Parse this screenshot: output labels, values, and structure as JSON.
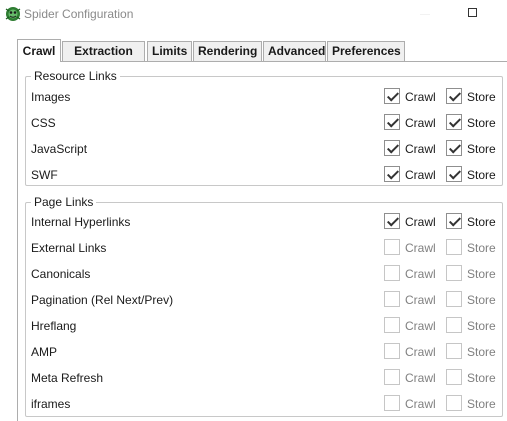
{
  "window": {
    "title": "Spider Configuration",
    "icon": "spider-frog-icon"
  },
  "tabs": [
    {
      "label": "Crawl",
      "active": true
    },
    {
      "label": "Extraction",
      "active": false
    },
    {
      "label": "Limits",
      "active": false
    },
    {
      "label": "Rendering",
      "active": false
    },
    {
      "label": "Advanced",
      "active": false
    },
    {
      "label": "Preferences",
      "active": false
    }
  ],
  "resource_links": {
    "legend": "Resource Links",
    "crawl_label": "Crawl",
    "store_label": "Store",
    "rows": [
      {
        "label": "Images",
        "crawl": true,
        "store": true
      },
      {
        "label": "CSS",
        "crawl": true,
        "store": true
      },
      {
        "label": "JavaScript",
        "crawl": true,
        "store": true
      },
      {
        "label": "SWF",
        "crawl": true,
        "store": true
      }
    ]
  },
  "page_links": {
    "legend": "Page Links",
    "crawl_label": "Crawl",
    "store_label": "Store",
    "rows": [
      {
        "label": "Internal Hyperlinks",
        "crawl": true,
        "store": true
      },
      {
        "label": "External Links",
        "crawl": false,
        "store": false
      },
      {
        "label": "Canonicals",
        "crawl": false,
        "store": false
      },
      {
        "label": "Pagination (Rel Next/Prev)",
        "crawl": false,
        "store": false
      },
      {
        "label": "Hreflang",
        "crawl": false,
        "store": false
      },
      {
        "label": "AMP",
        "crawl": false,
        "store": false
      },
      {
        "label": "Meta Refresh",
        "crawl": false,
        "store": false
      },
      {
        "label": "iframes",
        "crawl": false,
        "store": false
      }
    ]
  }
}
